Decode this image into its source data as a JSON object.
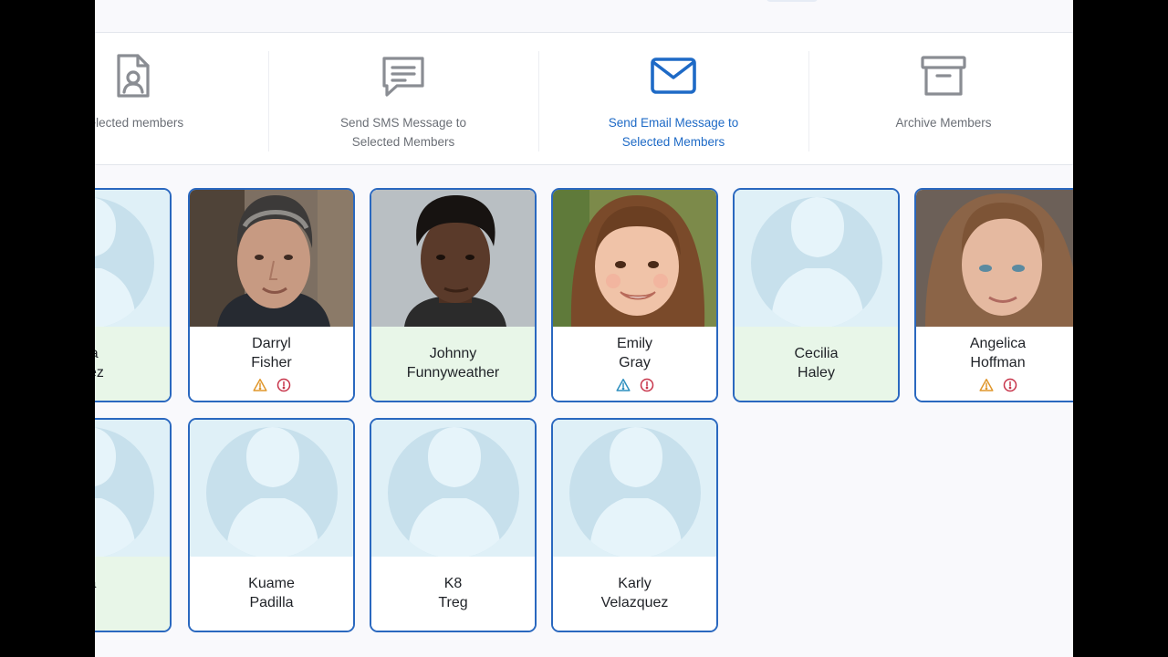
{
  "actions": [
    {
      "id": "export",
      "label": "selected members",
      "icon": "contact-file-icon",
      "active": false
    },
    {
      "id": "sms",
      "label": "Send SMS Message to\nSelected Members",
      "icon": "message-icon",
      "active": false
    },
    {
      "id": "email",
      "label": "Send Email Message to\nSelected Members",
      "icon": "envelope-icon",
      "active": true
    },
    {
      "id": "archive",
      "label": "Archive Members",
      "icon": "archive-box-icon",
      "active": false
    }
  ],
  "colors": {
    "accent": "#2a68bf",
    "active_text": "#1e6ac6",
    "warning": "#e0972c",
    "danger": "#c7344a",
    "info": "#2d8fbf",
    "green_bg": "#e8f6e8"
  },
  "members": [
    {
      "first": "ma",
      "last": "ndez",
      "photo": "placeholder-avatar",
      "green": true,
      "alerts": []
    },
    {
      "first": "Darryl",
      "last": "Fisher",
      "photo": "photo-man-gray-hair",
      "green": false,
      "alerts": [
        "warning-triangle-icon",
        "alert-circle-icon"
      ]
    },
    {
      "first": "Johnny",
      "last": "Funnyweather",
      "photo": "photo-young-man",
      "green": true,
      "alerts": []
    },
    {
      "first": "Emily",
      "last": "Gray",
      "photo": "photo-girl",
      "green": false,
      "alerts": [
        "info-triangle-icon",
        "alert-circle-icon"
      ]
    },
    {
      "first": "Cecilia",
      "last": "Haley",
      "photo": "placeholder-avatar",
      "green": true,
      "alerts": []
    },
    {
      "first": "Angelica",
      "last": "Hoffman",
      "photo": "photo-woman",
      "green": false,
      "alerts": [
        "warning-triangle-icon",
        "alert-circle-icon"
      ]
    },
    {
      "first": "na",
      "last": "r",
      "photo": "placeholder-avatar",
      "green": true,
      "alerts": []
    },
    {
      "first": "Kuame",
      "last": "Padilla",
      "photo": "placeholder-avatar",
      "green": false,
      "alerts": []
    },
    {
      "first": "K8",
      "last": "Treg",
      "photo": "placeholder-avatar",
      "green": false,
      "alerts": []
    },
    {
      "first": "Karly",
      "last": "Velazquez",
      "photo": "placeholder-avatar",
      "green": false,
      "alerts": []
    }
  ]
}
